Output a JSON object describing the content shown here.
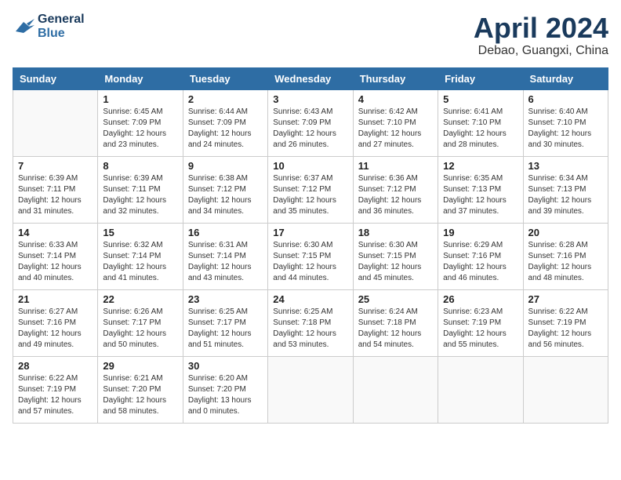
{
  "header": {
    "logo_line1": "General",
    "logo_line2": "Blue",
    "month": "April 2024",
    "location": "Debao, Guangxi, China"
  },
  "weekdays": [
    "Sunday",
    "Monday",
    "Tuesday",
    "Wednesday",
    "Thursday",
    "Friday",
    "Saturday"
  ],
  "weeks": [
    [
      {
        "day": "",
        "sunrise": "",
        "sunset": "",
        "daylight": ""
      },
      {
        "day": "1",
        "sunrise": "Sunrise: 6:45 AM",
        "sunset": "Sunset: 7:09 PM",
        "daylight": "Daylight: 12 hours and 23 minutes."
      },
      {
        "day": "2",
        "sunrise": "Sunrise: 6:44 AM",
        "sunset": "Sunset: 7:09 PM",
        "daylight": "Daylight: 12 hours and 24 minutes."
      },
      {
        "day": "3",
        "sunrise": "Sunrise: 6:43 AM",
        "sunset": "Sunset: 7:09 PM",
        "daylight": "Daylight: 12 hours and 26 minutes."
      },
      {
        "day": "4",
        "sunrise": "Sunrise: 6:42 AM",
        "sunset": "Sunset: 7:10 PM",
        "daylight": "Daylight: 12 hours and 27 minutes."
      },
      {
        "day": "5",
        "sunrise": "Sunrise: 6:41 AM",
        "sunset": "Sunset: 7:10 PM",
        "daylight": "Daylight: 12 hours and 28 minutes."
      },
      {
        "day": "6",
        "sunrise": "Sunrise: 6:40 AM",
        "sunset": "Sunset: 7:10 PM",
        "daylight": "Daylight: 12 hours and 30 minutes."
      }
    ],
    [
      {
        "day": "7",
        "sunrise": "Sunrise: 6:39 AM",
        "sunset": "Sunset: 7:11 PM",
        "daylight": "Daylight: 12 hours and 31 minutes."
      },
      {
        "day": "8",
        "sunrise": "Sunrise: 6:39 AM",
        "sunset": "Sunset: 7:11 PM",
        "daylight": "Daylight: 12 hours and 32 minutes."
      },
      {
        "day": "9",
        "sunrise": "Sunrise: 6:38 AM",
        "sunset": "Sunset: 7:12 PM",
        "daylight": "Daylight: 12 hours and 34 minutes."
      },
      {
        "day": "10",
        "sunrise": "Sunrise: 6:37 AM",
        "sunset": "Sunset: 7:12 PM",
        "daylight": "Daylight: 12 hours and 35 minutes."
      },
      {
        "day": "11",
        "sunrise": "Sunrise: 6:36 AM",
        "sunset": "Sunset: 7:12 PM",
        "daylight": "Daylight: 12 hours and 36 minutes."
      },
      {
        "day": "12",
        "sunrise": "Sunrise: 6:35 AM",
        "sunset": "Sunset: 7:13 PM",
        "daylight": "Daylight: 12 hours and 37 minutes."
      },
      {
        "day": "13",
        "sunrise": "Sunrise: 6:34 AM",
        "sunset": "Sunset: 7:13 PM",
        "daylight": "Daylight: 12 hours and 39 minutes."
      }
    ],
    [
      {
        "day": "14",
        "sunrise": "Sunrise: 6:33 AM",
        "sunset": "Sunset: 7:14 PM",
        "daylight": "Daylight: 12 hours and 40 minutes."
      },
      {
        "day": "15",
        "sunrise": "Sunrise: 6:32 AM",
        "sunset": "Sunset: 7:14 PM",
        "daylight": "Daylight: 12 hours and 41 minutes."
      },
      {
        "day": "16",
        "sunrise": "Sunrise: 6:31 AM",
        "sunset": "Sunset: 7:14 PM",
        "daylight": "Daylight: 12 hours and 43 minutes."
      },
      {
        "day": "17",
        "sunrise": "Sunrise: 6:30 AM",
        "sunset": "Sunset: 7:15 PM",
        "daylight": "Daylight: 12 hours and 44 minutes."
      },
      {
        "day": "18",
        "sunrise": "Sunrise: 6:30 AM",
        "sunset": "Sunset: 7:15 PM",
        "daylight": "Daylight: 12 hours and 45 minutes."
      },
      {
        "day": "19",
        "sunrise": "Sunrise: 6:29 AM",
        "sunset": "Sunset: 7:16 PM",
        "daylight": "Daylight: 12 hours and 46 minutes."
      },
      {
        "day": "20",
        "sunrise": "Sunrise: 6:28 AM",
        "sunset": "Sunset: 7:16 PM",
        "daylight": "Daylight: 12 hours and 48 minutes."
      }
    ],
    [
      {
        "day": "21",
        "sunrise": "Sunrise: 6:27 AM",
        "sunset": "Sunset: 7:16 PM",
        "daylight": "Daylight: 12 hours and 49 minutes."
      },
      {
        "day": "22",
        "sunrise": "Sunrise: 6:26 AM",
        "sunset": "Sunset: 7:17 PM",
        "daylight": "Daylight: 12 hours and 50 minutes."
      },
      {
        "day": "23",
        "sunrise": "Sunrise: 6:25 AM",
        "sunset": "Sunset: 7:17 PM",
        "daylight": "Daylight: 12 hours and 51 minutes."
      },
      {
        "day": "24",
        "sunrise": "Sunrise: 6:25 AM",
        "sunset": "Sunset: 7:18 PM",
        "daylight": "Daylight: 12 hours and 53 minutes."
      },
      {
        "day": "25",
        "sunrise": "Sunrise: 6:24 AM",
        "sunset": "Sunset: 7:18 PM",
        "daylight": "Daylight: 12 hours and 54 minutes."
      },
      {
        "day": "26",
        "sunrise": "Sunrise: 6:23 AM",
        "sunset": "Sunset: 7:19 PM",
        "daylight": "Daylight: 12 hours and 55 minutes."
      },
      {
        "day": "27",
        "sunrise": "Sunrise: 6:22 AM",
        "sunset": "Sunset: 7:19 PM",
        "daylight": "Daylight: 12 hours and 56 minutes."
      }
    ],
    [
      {
        "day": "28",
        "sunrise": "Sunrise: 6:22 AM",
        "sunset": "Sunset: 7:19 PM",
        "daylight": "Daylight: 12 hours and 57 minutes."
      },
      {
        "day": "29",
        "sunrise": "Sunrise: 6:21 AM",
        "sunset": "Sunset: 7:20 PM",
        "daylight": "Daylight: 12 hours and 58 minutes."
      },
      {
        "day": "30",
        "sunrise": "Sunrise: 6:20 AM",
        "sunset": "Sunset: 7:20 PM",
        "daylight": "Daylight: 13 hours and 0 minutes."
      },
      {
        "day": "",
        "sunrise": "",
        "sunset": "",
        "daylight": ""
      },
      {
        "day": "",
        "sunrise": "",
        "sunset": "",
        "daylight": ""
      },
      {
        "day": "",
        "sunrise": "",
        "sunset": "",
        "daylight": ""
      },
      {
        "day": "",
        "sunrise": "",
        "sunset": "",
        "daylight": ""
      }
    ]
  ]
}
